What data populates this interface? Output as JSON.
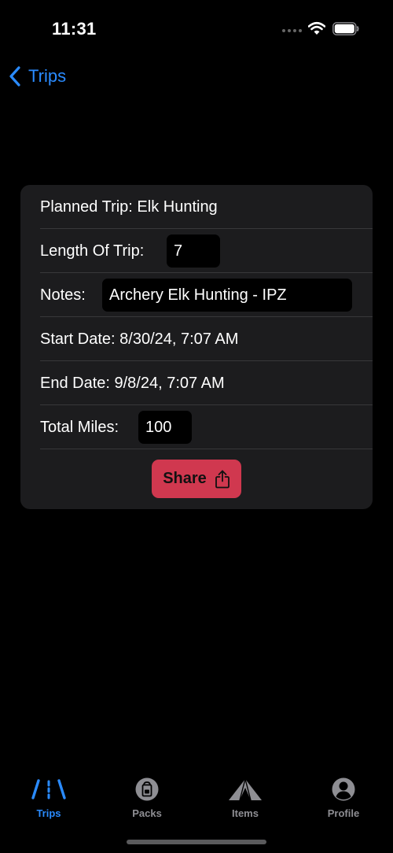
{
  "status_bar": {
    "time": "11:31"
  },
  "nav": {
    "back_label": "Trips"
  },
  "trip_card": {
    "planned_trip": "Planned Trip: Elk Hunting",
    "length_label": "Length Of Trip:",
    "length_value": "7",
    "notes_label": "Notes:",
    "notes_value": "Archery Elk Hunting - IPZ",
    "start_date": "Start Date: 8/30/24, 7:07 AM",
    "end_date": "End Date: 9/8/24, 7:07 AM",
    "miles_label": "Total Miles:",
    "miles_value": "100",
    "share_label": "Share"
  },
  "tab_bar": {
    "tabs": [
      {
        "label": "Trips",
        "icon": "road-icon",
        "active": true
      },
      {
        "label": "Packs",
        "icon": "backpack-icon",
        "active": false
      },
      {
        "label": "Items",
        "icon": "tent-icon",
        "active": false
      },
      {
        "label": "Profile",
        "icon": "person-circle-icon",
        "active": false
      }
    ]
  },
  "colors": {
    "accent": "#2a8bff",
    "share": "#d0384f",
    "card": "#1c1c1e",
    "inactive_tab": "#8e8e93"
  }
}
